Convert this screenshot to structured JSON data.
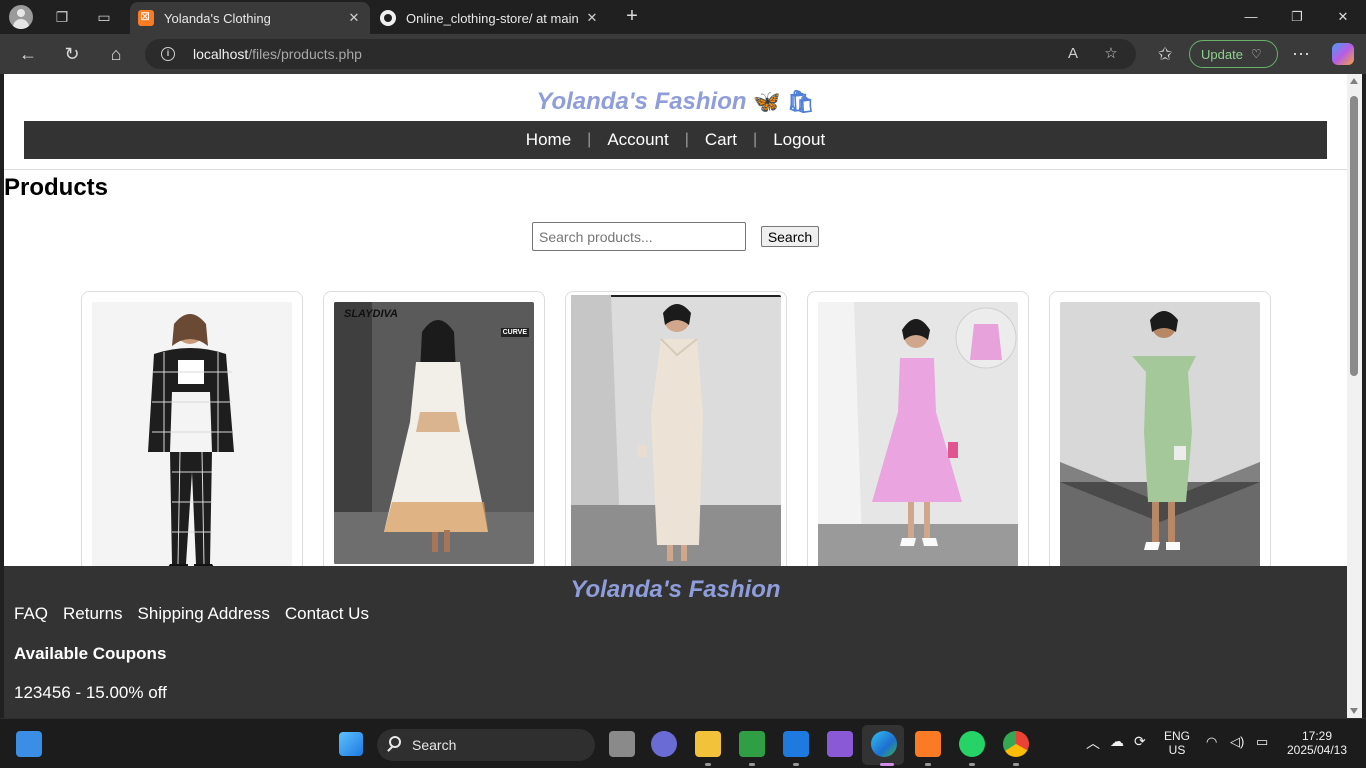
{
  "browser": {
    "tabs": [
      {
        "title": "Yolanda's Clothing",
        "active": true,
        "favicon": "xampp-icon"
      },
      {
        "title": "Online_clothing-store/ at main · Y",
        "active": false,
        "favicon": "github-icon"
      }
    ],
    "url_host": "localhost",
    "url_path": "/files/products.php",
    "update_label": "Update"
  },
  "site": {
    "title": "Yolanda's Fashion",
    "title_icons": "🦋 🛍",
    "nav": [
      "Home",
      "Account",
      "Cart",
      "Logout"
    ],
    "nav_separator": "|"
  },
  "products_page": {
    "heading": "Products",
    "search_placeholder": "Search products...",
    "search_button": "Search",
    "products": [
      {
        "image": "plaid-suit-photo",
        "colors": {
          "bg": "#f4f4f4",
          "garment": "#1e1e1e"
        }
      },
      {
        "image": "white-floral-dress-photo",
        "badge_left": "SLAYDIVA",
        "badge_right": "CURVE",
        "colors": {
          "bg": "#5a5a5a",
          "garment": "#f2efe8"
        }
      },
      {
        "image": "ivory-one-shoulder-dress-photo",
        "colors": {
          "bg": "#dcdcdc",
          "garment": "#ece3d6"
        }
      },
      {
        "image": "pink-midi-dress-photo",
        "colors": {
          "bg": "#e6e6e6",
          "garment": "#eaa4df"
        }
      },
      {
        "image": "sage-bodycon-dress-photo",
        "colors": {
          "bg": "#d8d8d8",
          "garment": "#a5c89a"
        }
      }
    ]
  },
  "footer": {
    "title": "Yolanda's Fashion",
    "links": [
      "FAQ",
      "Returns",
      "Shipping Address",
      "Contact Us"
    ],
    "coupons_heading": "Available Coupons",
    "coupons": [
      "123456 - 15.00% off"
    ]
  },
  "taskbar": {
    "search_label": "Search",
    "language": "ENG",
    "region": "US",
    "time": "17:29",
    "date": "2025/04/13"
  },
  "colors": {
    "brand": "#8f9edb",
    "nav_bg": "#333333",
    "footer_bg": "#333333",
    "update_green": "#66b26a"
  }
}
